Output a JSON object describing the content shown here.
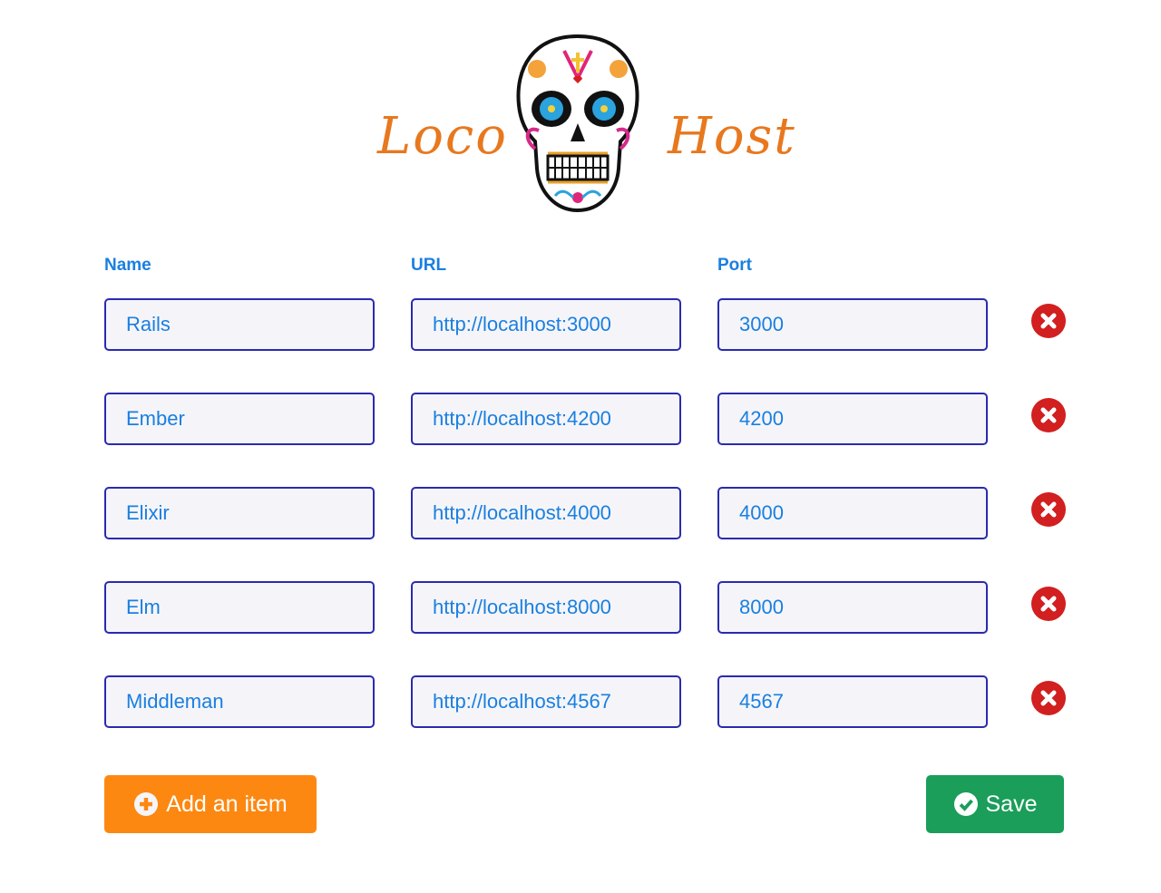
{
  "logo": {
    "left_text": "Loco",
    "right_text": "Host",
    "image": "sugar-skull-logo",
    "text_color": "#e8781e"
  },
  "columns": {
    "name": "Name",
    "url": "URL",
    "port": "Port"
  },
  "items": [
    {
      "name": "Rails",
      "url": "http://localhost:3000",
      "port": "3000"
    },
    {
      "name": "Ember",
      "url": "http://localhost:4200",
      "port": "4200"
    },
    {
      "name": "Elixir",
      "url": "http://localhost:4000",
      "port": "4000"
    },
    {
      "name": "Elm",
      "url": "http://localhost:8000",
      "port": "8000"
    },
    {
      "name": "Middleman",
      "url": "http://localhost:4567",
      "port": "4567"
    }
  ],
  "delete_icon": "times-circle-icon",
  "actions": {
    "add_label": "Add an item",
    "add_icon": "plus-circle-icon",
    "save_label": "Save",
    "save_icon": "check-circle-icon"
  },
  "colors": {
    "accent": "#1a7fe0",
    "border": "#2a2ab0",
    "add": "#fc8812",
    "save": "#1a9e5a",
    "delete": "#d21f1f"
  }
}
